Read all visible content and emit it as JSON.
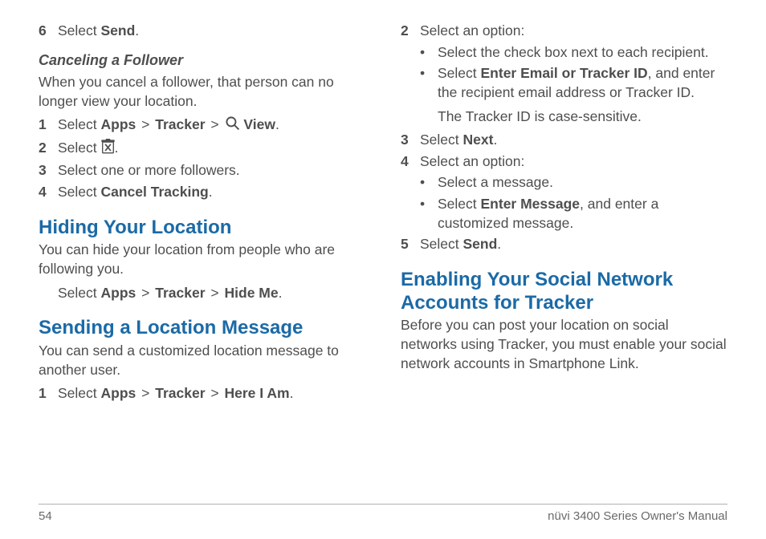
{
  "left": {
    "step6_pre": "Select ",
    "step6_bold": "Send",
    "step6_post": ".",
    "cancel_heading": "Canceling a Follower",
    "cancel_intro": "When you cancel a follower, that person can no longer view your location.",
    "c1_pre": "Select ",
    "c1_apps": "Apps",
    "c1_tracker": "Tracker",
    "c1_view": "View",
    "c1_post": ".",
    "c2_pre": "Select ",
    "c2_post": ".",
    "c3": "Select one or more followers.",
    "c4_pre": "Select ",
    "c4_bold": "Cancel Tracking",
    "c4_post": ".",
    "hide_heading": "Hiding Your Location",
    "hide_intro": "You can hide your location from people who are following you.",
    "hide_step_pre": "Select ",
    "hide_apps": "Apps",
    "hide_tracker": "Tracker",
    "hide_hideme": "Hide Me",
    "hide_post": ".",
    "send_heading": "Sending a Location Message",
    "send_intro": "You can send a customized location message to another user.",
    "s1_pre": "Select ",
    "s1_apps": "Apps",
    "s1_tracker": "Tracker",
    "s1_here": "Here I Am",
    "s1_post": "."
  },
  "right": {
    "r2": "Select an option:",
    "r2a": "Select the check box next to each recipient.",
    "r2b_pre": "Select ",
    "r2b_bold": "Enter Email or Tracker ID",
    "r2b_post": ", and enter the recipient email address or Tracker ID.",
    "r2note": "The Tracker ID is case-sensitive.",
    "r3_pre": "Select ",
    "r3_bold": "Next",
    "r3_post": ".",
    "r4": "Select an option:",
    "r4a": "Select a message.",
    "r4b_pre": "Select ",
    "r4b_bold": "Enter Message",
    "r4b_post": ", and enter a customized message.",
    "r5_pre": "Select ",
    "r5_bold": "Send",
    "r5_post": ".",
    "social_heading": "Enabling Your Social Network Accounts for Tracker",
    "social_intro": "Before you can post your location on social networks using Tracker, you must enable your social network accounts in Smartphone Link."
  },
  "gt": ">",
  "nums": {
    "n1": "1",
    "n2": "2",
    "n3": "3",
    "n4": "4",
    "n5": "5",
    "n6": "6"
  },
  "bullet": "•",
  "footer": {
    "page": "54",
    "title": "nüvi 3400 Series Owner's Manual"
  }
}
